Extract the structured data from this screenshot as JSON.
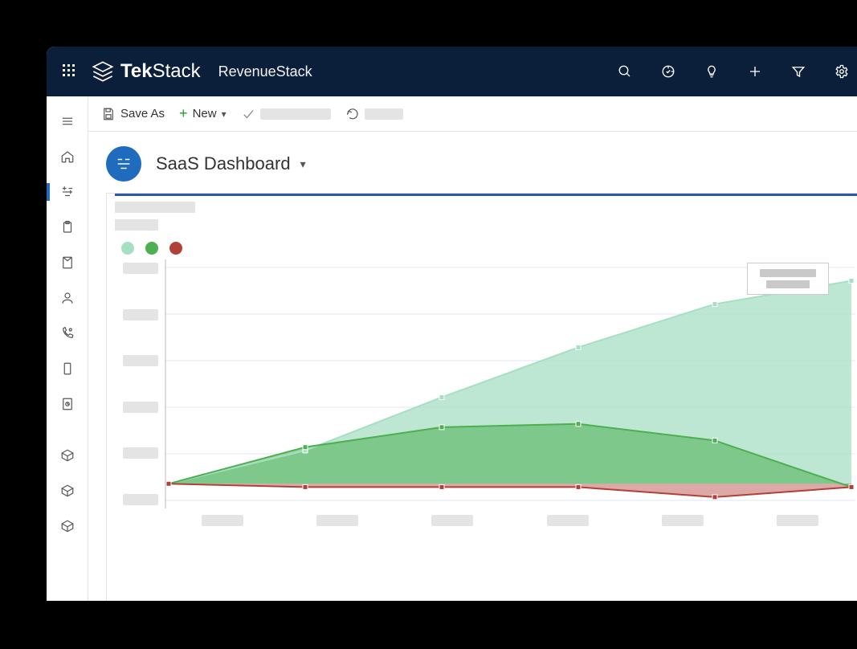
{
  "topbar": {
    "brand_prefix": "Tek",
    "brand_suffix": "Stack",
    "subapp": "RevenueStack",
    "icons": [
      "search-icon",
      "target-icon",
      "lightbulb-icon",
      "plus-icon",
      "filter-icon",
      "gear-icon"
    ]
  },
  "leftnav": {
    "items": [
      {
        "name": "menu-icon"
      },
      {
        "name": "home-icon"
      },
      {
        "name": "dashboard-icon",
        "active": true
      },
      {
        "name": "clipboard-icon"
      },
      {
        "name": "bookmark-icon"
      },
      {
        "name": "person-icon"
      },
      {
        "name": "phone-settings-icon"
      },
      {
        "name": "device-icon"
      },
      {
        "name": "report-icon"
      }
    ],
    "items2": [
      {
        "name": "cube-icon"
      },
      {
        "name": "cube-icon"
      },
      {
        "name": "cube-icon"
      }
    ]
  },
  "cmdbar": {
    "save_as": "Save As",
    "new_label": "New"
  },
  "header": {
    "title": "SaaS Dashboard"
  },
  "chart_data": {
    "type": "area",
    "x": [
      0,
      1,
      2,
      3,
      4,
      5
    ],
    "series": [
      {
        "name": "series-light-green",
        "color": "#a7dfc3",
        "fill": "rgba(167,223,195,.75)",
        "values": [
          10,
          30,
          62,
          92,
          118,
          132
        ]
      },
      {
        "name": "series-green",
        "color": "#4caf50",
        "fill": "rgba(76,175,80,.55)",
        "values": [
          10,
          32,
          44,
          46,
          36,
          8
        ]
      },
      {
        "name": "series-red",
        "color": "#b14039",
        "fill": "rgba(177,64,57,.45)",
        "values": [
          10,
          8,
          8,
          8,
          2,
          8
        ]
      }
    ],
    "x_tick_count": 6,
    "y_tick_count": 6,
    "ylim": [
      0,
      140
    ],
    "grid": true,
    "legend_position": "top-left",
    "baseline_y": 10
  },
  "colors": {
    "navy": "#0b1f3a",
    "accent_blue": "#1f6cbf",
    "skeleton": "#e4e4e4"
  }
}
